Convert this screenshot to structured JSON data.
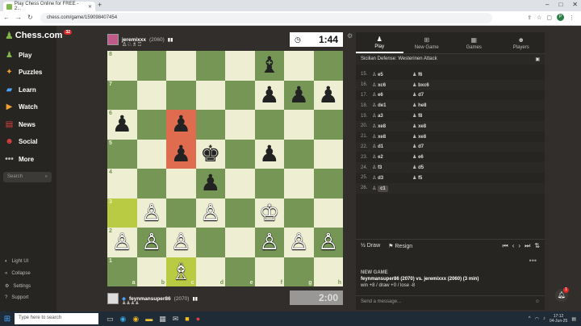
{
  "browser": {
    "tab_title": "Play Chess Online for FREE - 2...",
    "url": "chess.com/game/159098407454"
  },
  "sidebar": {
    "logo": "Chess.com",
    "logo_badge": "32",
    "items": [
      {
        "label": "Play",
        "icon": "play-icon"
      },
      {
        "label": "Puzzles",
        "icon": "puzzle-icon"
      },
      {
        "label": "Learn",
        "icon": "learn-icon"
      },
      {
        "label": "Watch",
        "icon": "watch-icon"
      },
      {
        "label": "News",
        "icon": "news-icon"
      },
      {
        "label": "Social",
        "icon": "social-icon"
      },
      {
        "label": "More",
        "icon": "more-icon"
      }
    ],
    "search_placeholder": "Search",
    "footer": [
      {
        "label": "Light UI"
      },
      {
        "label": "Collapse"
      },
      {
        "label": "Settings"
      },
      {
        "label": "Support"
      }
    ]
  },
  "top_player": {
    "name": "jeremixxx",
    "rating": "(2060)",
    "clock": "1:44"
  },
  "bottom_player": {
    "name": "feynmansuper86",
    "rating": "(2070)",
    "clock": "2:00"
  },
  "board": {
    "ranks": [
      "8",
      "7",
      "6",
      "5",
      "4",
      "3",
      "2",
      "1"
    ],
    "files": [
      "a",
      "b",
      "c",
      "d",
      "e",
      "f",
      "g",
      "h"
    ],
    "pieces": {
      "f8": "♝",
      "f7": "♟",
      "g7": "♟",
      "h7": "♟",
      "a6": "♟",
      "c6": "♟",
      "c5": "♟",
      "d5": "♚",
      "f5": "♟",
      "d4": "♟",
      "b3": "♙",
      "d3": "♙",
      "f3": "♔",
      "a2": "♙",
      "b2": "♙",
      "c2": "♙",
      "f2": "♙",
      "g2": "♙",
      "h2": "♙",
      "c1": "♗"
    },
    "white_pieces": [
      "b3",
      "d3",
      "f3",
      "a2",
      "b2",
      "c2",
      "f2",
      "g2",
      "h2",
      "c1"
    ],
    "red_squares": [
      "c6",
      "c5"
    ],
    "yellow_squares": [
      "a3",
      "c1"
    ]
  },
  "panel": {
    "tabs": [
      "Play",
      "New Game",
      "Games",
      "Players"
    ],
    "opening": "Sicilian Defense: Westerinen Attack",
    "moves": [
      {
        "n": "15.",
        "w": "e5",
        "b": "f6"
      },
      {
        "n": "16.",
        "w": "xc6",
        "b": "bxc6"
      },
      {
        "n": "17.",
        "w": "e6",
        "b": "d7"
      },
      {
        "n": "18.",
        "w": "de1",
        "b": "he8"
      },
      {
        "n": "19.",
        "w": "a3",
        "b": "f8"
      },
      {
        "n": "20.",
        "w": "xe8",
        "b": "xe8"
      },
      {
        "n": "21.",
        "w": "xe8",
        "b": "xe8"
      },
      {
        "n": "22.",
        "w": "d1",
        "b": "d7"
      },
      {
        "n": "23.",
        "w": "e2",
        "b": "e6"
      },
      {
        "n": "24.",
        "w": "f3",
        "b": "d5"
      },
      {
        "n": "25.",
        "w": "d3",
        "b": "f5"
      },
      {
        "n": "26.",
        "w": "c1",
        "b": ""
      }
    ],
    "draw_label": "Draw",
    "resign_label": "Resign",
    "newgame_heading": "NEW GAME",
    "newgame_players": "feynmansuper86 (2070) vs. jeremixxx (2060) (3 min)",
    "newgame_record": "win +8 / draw +0 / lose -8",
    "chat_placeholder": "Send a message..."
  },
  "taskbar": {
    "search_placeholder": "Type here to search",
    "time": "17:12",
    "date": "04-Jun-25"
  }
}
